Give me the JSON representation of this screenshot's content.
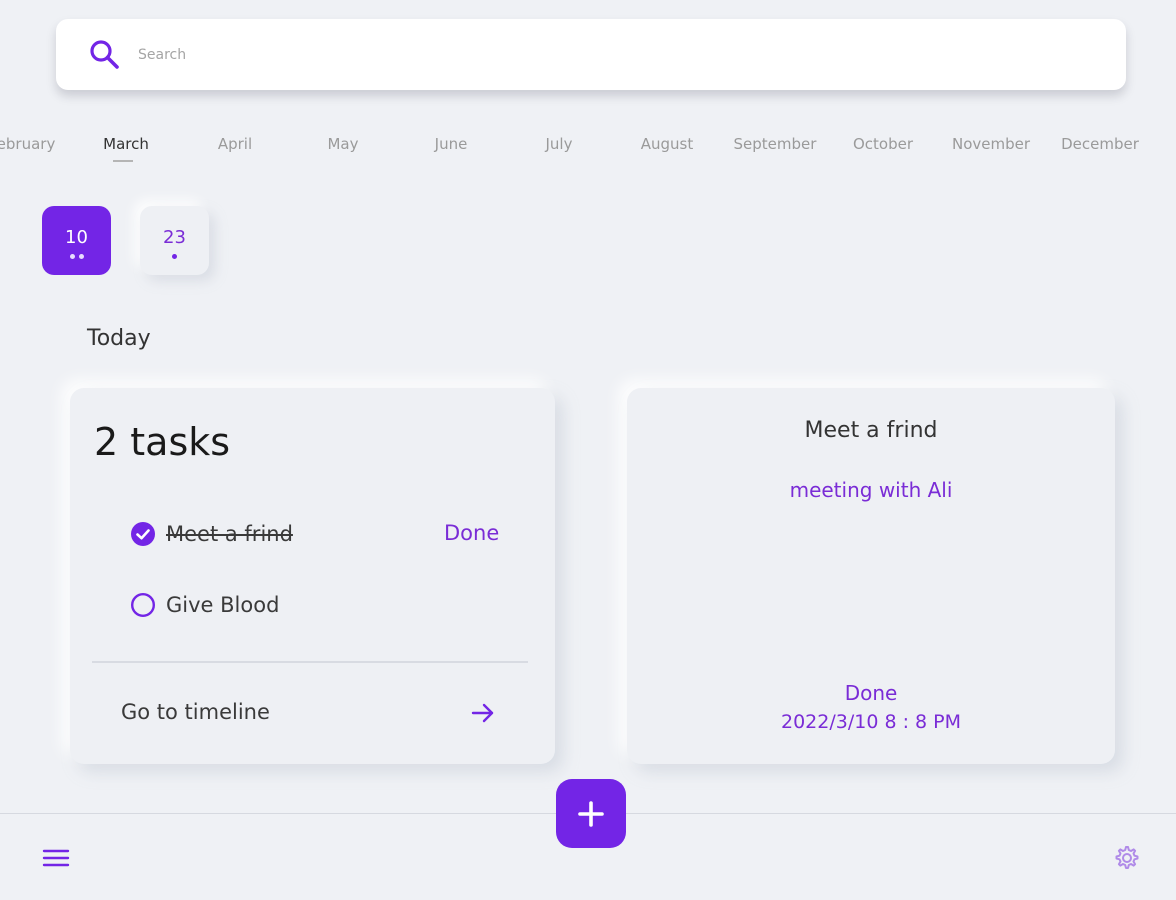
{
  "search": {
    "placeholder": "Search"
  },
  "months": [
    "ebruary",
    "March",
    "April",
    "May",
    "June",
    "July",
    "August",
    "September",
    "October",
    "November",
    "December"
  ],
  "active_month": "March",
  "days": [
    {
      "number": "10",
      "dots": 2,
      "selected": true
    },
    {
      "number": "23",
      "dots": 1,
      "selected": false
    }
  ],
  "today_label": "Today",
  "tasks_card": {
    "count_label": "2 tasks",
    "tasks": [
      {
        "text": "Meet a frind",
        "done": true
      },
      {
        "text": "Give Blood",
        "done": false
      }
    ],
    "done_label": "Done",
    "timeline_label": "Go to timeline"
  },
  "detail_card": {
    "title": "Meet a frind",
    "description": "meeting with Ali",
    "status": "Done",
    "datetime": "2022/3/10  8 : 8 PM"
  },
  "colors": {
    "accent": "#7325e6",
    "accent_text": "#7a2cd6",
    "background": "#eff1f5"
  },
  "icons": {
    "search": "search-icon",
    "check": "check-circle-icon",
    "circle": "empty-circle-icon",
    "arrow": "arrow-right-icon",
    "plus": "plus-icon",
    "menu": "hamburger-menu-icon",
    "settings": "gear-icon"
  }
}
